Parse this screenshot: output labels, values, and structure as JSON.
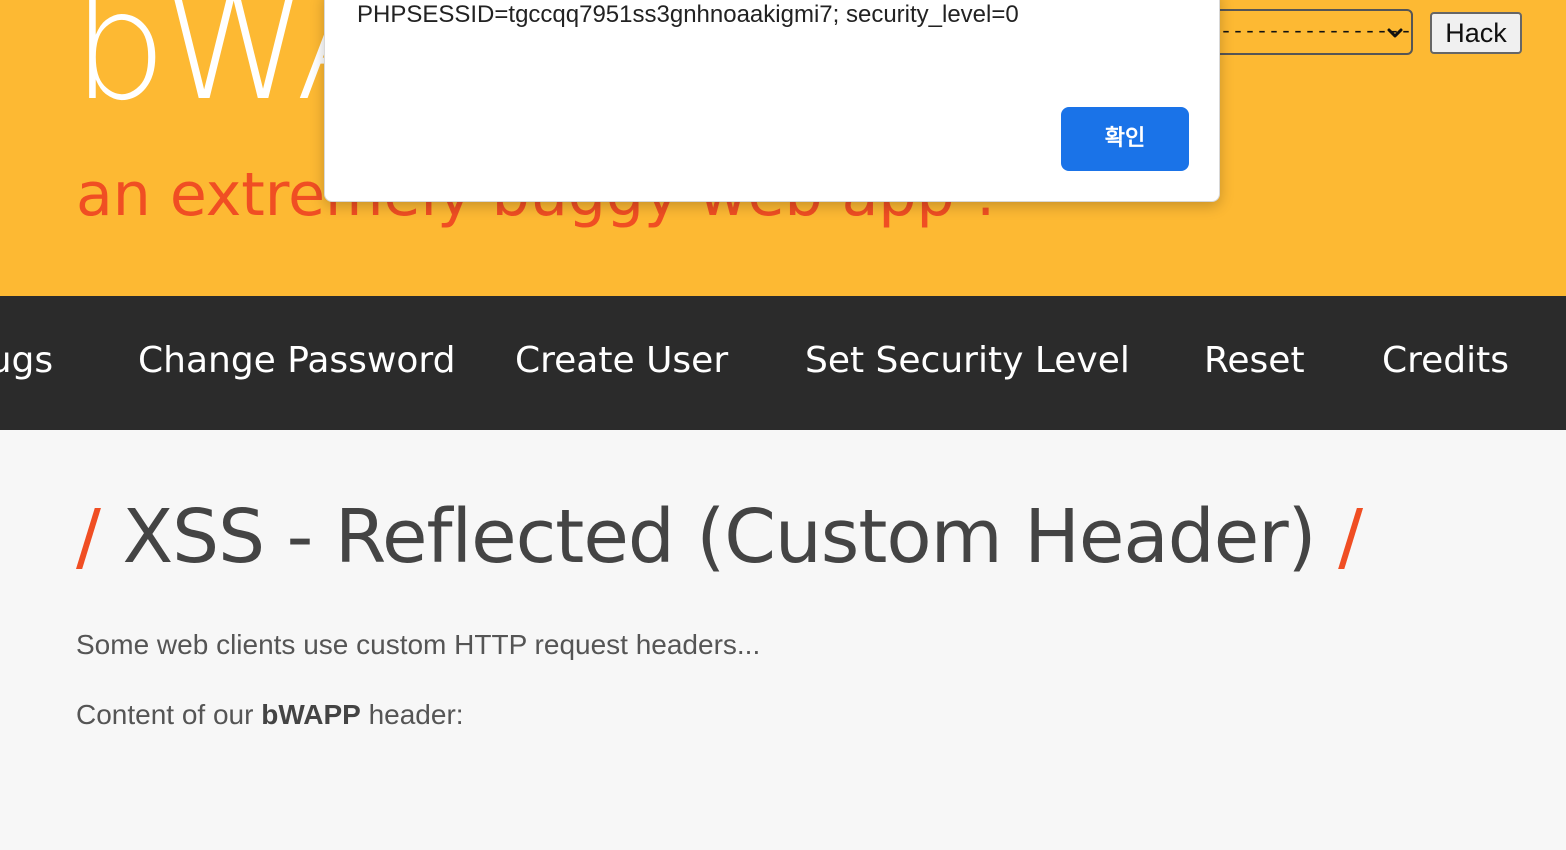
{
  "header": {
    "logo_text": "bWAPP",
    "tagline": "an extremely buggy web app !",
    "bug_select_value": "----------------",
    "hack_button": "Hack"
  },
  "nav": {
    "items": [
      {
        "label": "Bugs"
      },
      {
        "label": "Change Password"
      },
      {
        "label": "Create User"
      },
      {
        "label": "Set Security Level"
      },
      {
        "label": "Reset"
      },
      {
        "label": "Credits"
      }
    ]
  },
  "main": {
    "title_slash": "/",
    "title": "XSS - Reflected (Custom Header)",
    "intro": "Some web clients use custom HTTP request headers...",
    "content_prefix": "Content of our ",
    "content_brand": "bWAPP",
    "content_suffix": " header:"
  },
  "alert": {
    "message": "PHPSESSID=tgccqq7951ss3gnhnoaakigmi7; security_level=0",
    "ok_label": "확인"
  },
  "colors": {
    "header_bg": "#fdb933",
    "nav_bg": "#2b2b2b",
    "accent": "#f04e23",
    "dialog_button": "#1a73e8"
  }
}
